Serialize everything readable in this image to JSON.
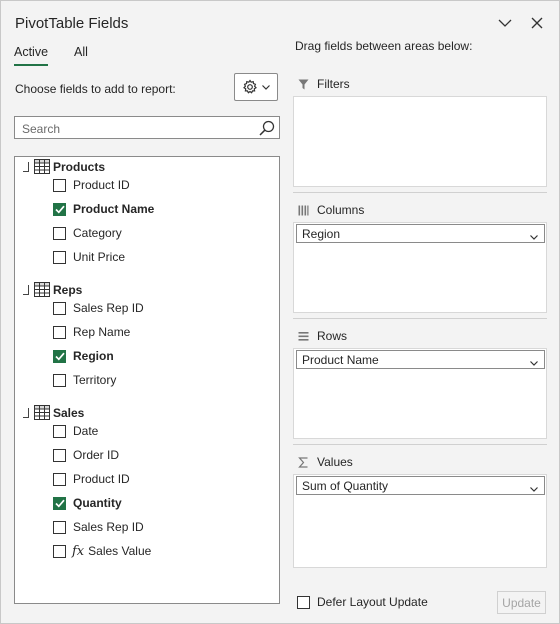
{
  "header": {
    "title": "PivotTable Fields"
  },
  "tabs": [
    {
      "label": "Active",
      "active": true
    },
    {
      "label": "All",
      "active": false
    }
  ],
  "choose_label": "Choose fields to add to report:",
  "search": {
    "placeholder": "Search",
    "value": ""
  },
  "tables": [
    {
      "name": "Products",
      "fields": [
        {
          "label": "Product ID",
          "checked": false
        },
        {
          "label": "Product Name",
          "checked": true
        },
        {
          "label": "Category",
          "checked": false
        },
        {
          "label": "Unit Price",
          "checked": false
        }
      ]
    },
    {
      "name": "Reps",
      "fields": [
        {
          "label": "Sales Rep ID",
          "checked": false
        },
        {
          "label": "Rep Name",
          "checked": false
        },
        {
          "label": "Region",
          "checked": true
        },
        {
          "label": "Territory",
          "checked": false
        }
      ]
    },
    {
      "name": "Sales",
      "fields": [
        {
          "label": "Date",
          "checked": false
        },
        {
          "label": "Order ID",
          "checked": false
        },
        {
          "label": "Product ID",
          "checked": false
        },
        {
          "label": "Quantity",
          "checked": true
        },
        {
          "label": "Sales Rep ID",
          "checked": false
        },
        {
          "label": "Sales Value",
          "checked": false,
          "measure": true,
          "measure_icon": "fx"
        }
      ]
    }
  ],
  "areas": {
    "drag_label": "Drag fields between areas below:",
    "filters": {
      "label": "Filters",
      "items": []
    },
    "columns": {
      "label": "Columns",
      "items": [
        "Region"
      ]
    },
    "rows": {
      "label": "Rows",
      "items": [
        "Product Name"
      ]
    },
    "values": {
      "label": "Values",
      "items": [
        "Sum of Quantity"
      ]
    }
  },
  "footer": {
    "defer_label": "Defer Layout Update",
    "defer_checked": false,
    "update_label": "Update"
  },
  "colors": {
    "accent": "#217346",
    "pane_bg": "#f3f3f3"
  }
}
